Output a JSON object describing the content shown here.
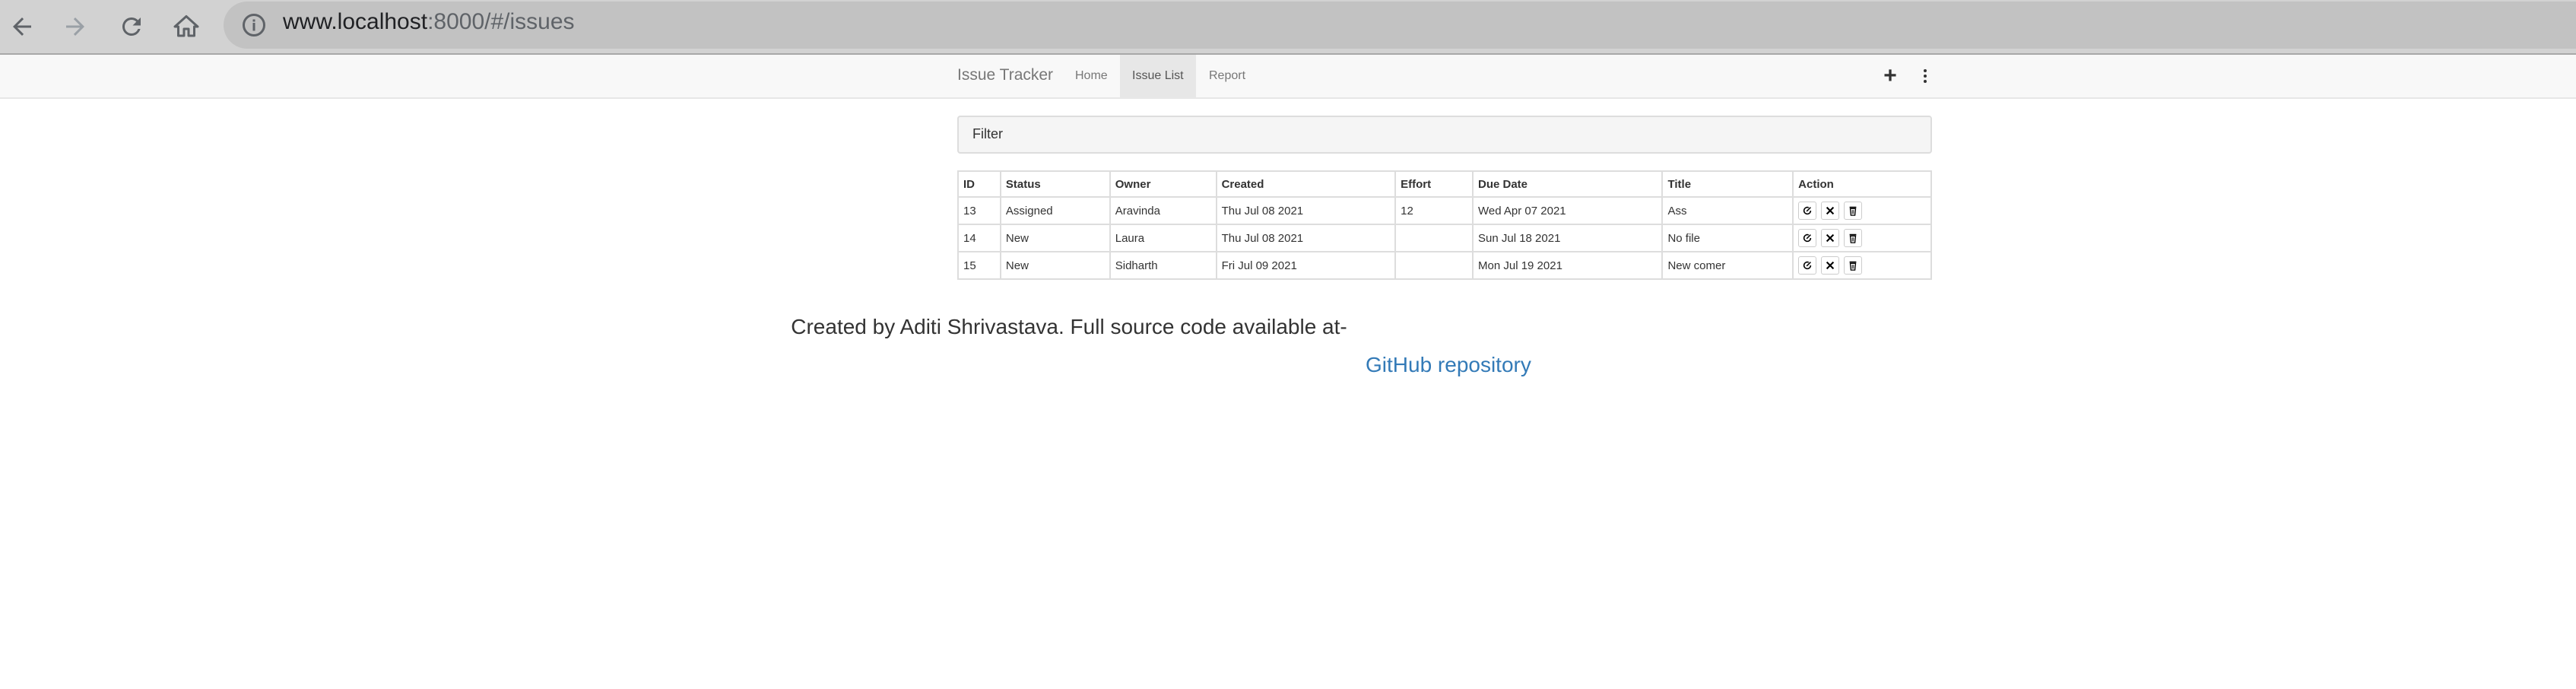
{
  "browser": {
    "url_host": "www.localhost",
    "url_path": ":8000/#/issues"
  },
  "navbar": {
    "brand": "Issue Tracker",
    "links": [
      "Home",
      "Issue List",
      "Report"
    ],
    "active": "Issue List",
    "add_label": "+"
  },
  "filter": {
    "label": "Filter"
  },
  "table": {
    "headers": [
      "ID",
      "Status",
      "Owner",
      "Created",
      "Effort",
      "Due Date",
      "Title",
      "Action"
    ],
    "rows": [
      [
        "13",
        "Assigned",
        "Aravinda",
        "Thu Jul 08 2021",
        "12",
        "Wed Apr 07 2021",
        "Ass"
      ],
      [
        "14",
        "New",
        "Laura",
        "Thu Jul 08 2021",
        "",
        "Sun Jul 18 2021",
        "No file"
      ],
      [
        "15",
        "New",
        "Sidharth",
        "Fri Jul 09 2021",
        "",
        "Mon Jul 19 2021",
        "New comer"
      ]
    ]
  },
  "footer": {
    "text": "Created by Aditi Shrivastava. Full source code available at-",
    "link": "GitHub repository"
  },
  "colors": {
    "link": "#337ab7",
    "navbar_bg": "#f8f8f8",
    "chrome_bg": "#d2d2d2"
  },
  "icons": [
    "back-icon",
    "forward-icon",
    "reload-icon",
    "home-icon",
    "info-icon",
    "plus-icon",
    "kebab-menu-icon",
    "edit-icon",
    "close-icon",
    "trash-icon"
  ]
}
